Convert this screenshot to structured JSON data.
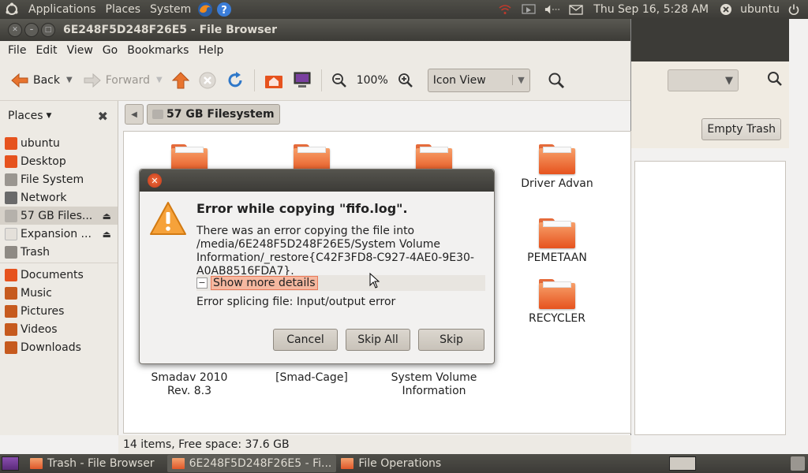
{
  "top_panel": {
    "menus": [
      "Applications",
      "Places",
      "System"
    ],
    "datetime": "Thu Sep 16,  5:28 AM",
    "user": "ubuntu"
  },
  "window": {
    "title": "6E248F5D248F26E5 - File Browser",
    "menubar": [
      "File",
      "Edit",
      "View",
      "Go",
      "Bookmarks",
      "Help"
    ],
    "toolbar": {
      "back_label": "Back",
      "forward_label": "Forward",
      "zoom": "100%",
      "view_mode": "Icon View"
    },
    "sidebar": {
      "header": "Places",
      "places": [
        {
          "label": "ubuntu",
          "icon": "home-icon"
        },
        {
          "label": "Desktop",
          "icon": "desktop-icon"
        },
        {
          "label": "File System",
          "icon": "drive-icon"
        },
        {
          "label": "Network",
          "icon": "network-icon"
        },
        {
          "label": "57 GB Files...",
          "icon": "drive-icon"
        },
        {
          "label": "Expansion ...",
          "icon": "drive-icon"
        },
        {
          "label": "Trash",
          "icon": "trash-icon"
        }
      ],
      "bookmarks": [
        {
          "label": "Documents",
          "icon": "folder-icon"
        },
        {
          "label": "Music",
          "icon": "music-icon"
        },
        {
          "label": "Pictures",
          "icon": "pictures-icon"
        },
        {
          "label": "Videos",
          "icon": "videos-icon"
        },
        {
          "label": "Downloads",
          "icon": "downloads-icon"
        }
      ]
    },
    "pathbar": {
      "current": "57 GB Filesystem"
    },
    "files": [
      {
        "name": ""
      },
      {
        "name": ""
      },
      {
        "name": ""
      },
      {
        "name": "Driver Advan"
      },
      {
        "name": "PEMETAAN"
      },
      {
        "name": "RECYCLER"
      },
      {
        "name": "Smadav 2010 Rev. 8.3"
      },
      {
        "name": "[Smad-Cage]"
      },
      {
        "name": "System Volume Information"
      }
    ],
    "status": "14 items, Free space: 37.6 GB"
  },
  "background_window": {
    "empty_trash_label": "Empty Trash"
  },
  "dialog": {
    "heading": "Error while copying \"fifo.log\".",
    "message": "There was an error copying the file into /media/6E248F5D248F26E5/System Volume Information/_restore{C42F3FD8-C927-4AE0-9E30-A0AB8516FDA7}.",
    "details_toggle": "Show more details",
    "error_detail": "Error splicing file: Input/output error",
    "buttons": {
      "cancel": "Cancel",
      "skip_all": "Skip All",
      "skip": "Skip"
    }
  },
  "taskbar": [
    {
      "label": "Trash - File Browser",
      "active": false
    },
    {
      "label": "6E248F5D248F26E5 - Fi...",
      "active": true
    },
    {
      "label": "File Operations",
      "active": false
    }
  ],
  "colors": {
    "folder": "#e6531e",
    "panel": "#3c3b37",
    "window_bg": "#f2f1f0",
    "dialog_close": "#e2532a"
  }
}
